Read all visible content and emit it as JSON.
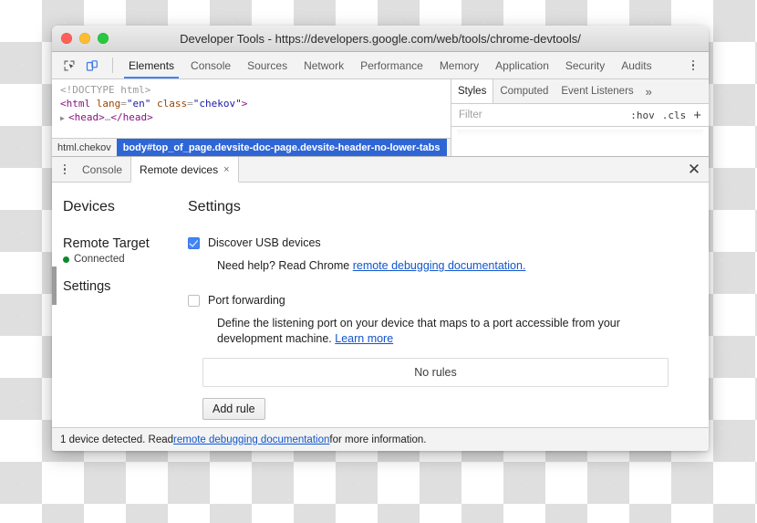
{
  "window": {
    "title": "Developer Tools - https://developers.google.com/web/tools/chrome-devtools/",
    "traffic_lights": [
      "close",
      "minimize",
      "zoom"
    ]
  },
  "toolbar": {
    "inspect_icon": "inspect-element-icon",
    "device_icon": "device-toolbar-icon",
    "tabs": [
      {
        "label": "Elements",
        "active": true
      },
      {
        "label": "Console",
        "active": false
      },
      {
        "label": "Sources",
        "active": false
      },
      {
        "label": "Network",
        "active": false
      },
      {
        "label": "Performance",
        "active": false
      },
      {
        "label": "Memory",
        "active": false
      },
      {
        "label": "Application",
        "active": false
      },
      {
        "label": "Security",
        "active": false
      },
      {
        "label": "Audits",
        "active": false
      }
    ],
    "more_icon": "kebab-menu-icon",
    "accent_color": "#4285f4"
  },
  "elements": {
    "dom": {
      "doctype": "<!DOCTYPE html>",
      "line2_open": "<html ",
      "line2_attr1": "lang",
      "line2_eq1": "=",
      "line2_val1": "\"en\"",
      "line2_attr2": "class",
      "line2_eq2": "=",
      "line2_val2": "\"chekov\"",
      "line2_close": ">",
      "line3_arrow": "▶",
      "line3_head": "<head>",
      "line3_headclose": "</head>"
    },
    "breadcrumb": [
      {
        "label": "html.chekov",
        "selected": false
      },
      {
        "label": "body#top_of_page.devsite-doc-page.devsite-header-no-lower-tabs",
        "selected": true
      }
    ],
    "breadcrumb_selected_color": "#2f66d6"
  },
  "styles": {
    "tabs": [
      {
        "label": "Styles",
        "active": true
      },
      {
        "label": "Computed",
        "active": false
      },
      {
        "label": "Event Listeners",
        "active": false
      }
    ],
    "more_label": "»",
    "filter_placeholder": "Filter",
    "filter_value": "",
    "hov_label": ":hov",
    "cls_label": ".cls",
    "plus_label": "+"
  },
  "drawer": {
    "menu_icon": "kebab-menu-icon",
    "tabs": [
      {
        "label": "Console",
        "active": false,
        "closable": false
      },
      {
        "label": "Remote devices",
        "active": true,
        "closable": true
      }
    ],
    "tab_close_glyph": "×",
    "close_glyph": "✕"
  },
  "remote_devices": {
    "sidebar": {
      "heading": "Devices",
      "target_name": "Remote Target",
      "status": "Connected",
      "status_color": "#0a8a2c",
      "settings_label": "Settings"
    },
    "settings": {
      "title": "Settings",
      "discover_usb": {
        "label": "Discover USB devices",
        "checked": true,
        "help_prefix": "Need help? Read Chrome ",
        "help_link": "remote debugging documentation."
      },
      "port_forwarding": {
        "label": "Port forwarding",
        "checked": false,
        "description_prefix": "Define the listening port on your device that maps to a port accessible from your development machine. ",
        "description_link": "Learn more",
        "rules_empty": "No rules",
        "add_rule_label": "Add rule"
      }
    },
    "checkbox_color": "#4285f4",
    "link_color": "#1155cc"
  },
  "statusbar": {
    "prefix": "1 device detected. Read ",
    "link": "remote debugging documentation",
    "suffix": " for more information."
  }
}
